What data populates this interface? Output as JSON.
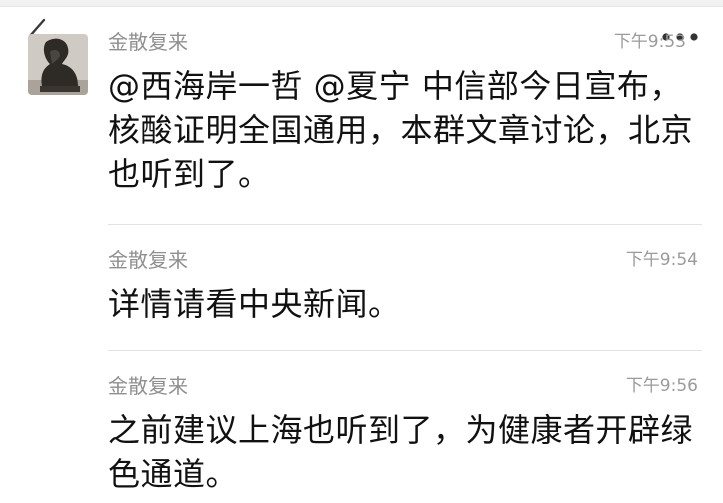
{
  "nav": {
    "back_icon": "chevron-left-icon",
    "more_icon": "more-dots-icon"
  },
  "messages": [
    {
      "sender": "金散复来",
      "time": "下午9:53",
      "text": "@西海岸一哲 @夏宁 中信部今日宣布，核酸证明全国通用，本群文章讨论，北京也听到了。"
    },
    {
      "sender": "金散复来",
      "time": "下午9:54",
      "text": "详情请看中央新闻。"
    },
    {
      "sender": "金散复来",
      "time": "下午9:56",
      "text": "之前建议上海也听到了，为健康者开辟绿色通道。"
    }
  ]
}
